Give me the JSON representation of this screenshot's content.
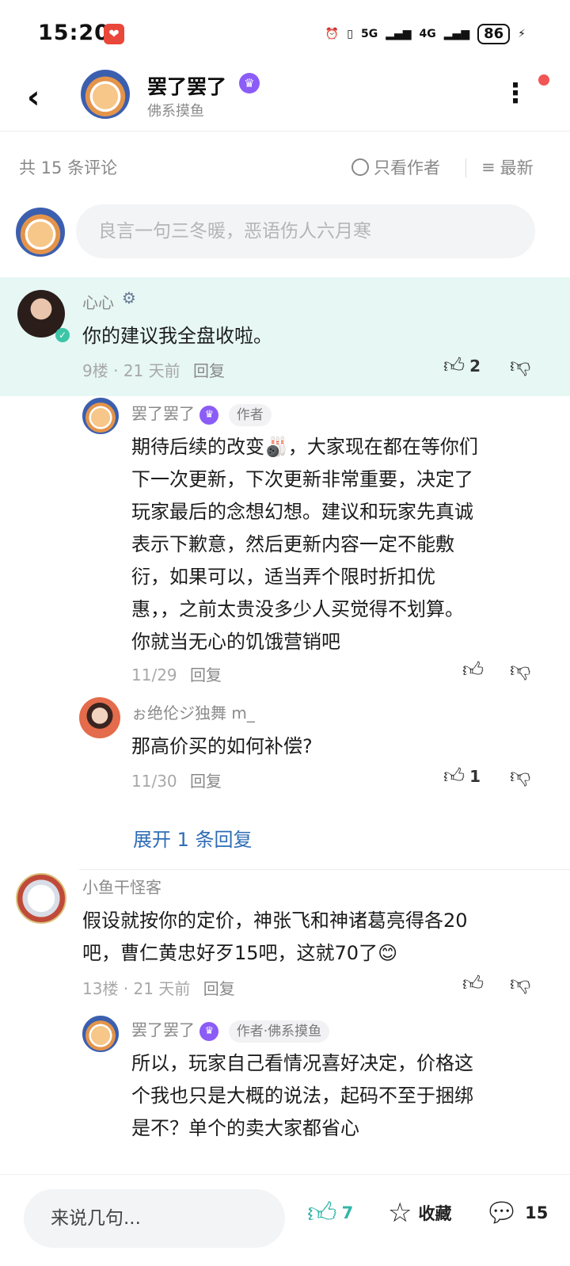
{
  "status_bar": {
    "time": "15:20",
    "signal_5g": "5G",
    "signal_4g": "4G",
    "battery": "86"
  },
  "header": {
    "title": "罢了罢了",
    "subtitle": "佛系摸鱼"
  },
  "comments_bar": {
    "count_label": "共 15 条评论",
    "author_only": "只看作者",
    "sort_label": "最新"
  },
  "input": {
    "placeholder": "良言一句三冬暖，恶语伤人六月寒"
  },
  "comments": [
    {
      "user": "心心",
      "text": "你的建议我全盘收啦。",
      "floor": "9楼",
      "time": "21 天前",
      "reply": "回复",
      "likes": "2"
    },
    {
      "user": "罢了罢了",
      "tag": "作者",
      "lines": [
        "期待后续的改变🎳，大家现在都在等你们",
        "下一次更新，下次更新非常重要，决定了",
        "玩家最后的念想幻想。建议和玩家先真诚",
        "表示下歉意，然后更新内容一定不能敷",
        "衍，如果可以，适当弄个限时折扣优",
        "惠，，之前太贵没多少人买觉得不划算。",
        "你就当无心的饥饿营销吧"
      ],
      "time": "11/29",
      "reply": "回复"
    },
    {
      "user": "ぉ绝伦ジ独舞 m_",
      "text": "那高价买的如何补偿?",
      "time": "11/30",
      "reply": "回复",
      "likes": "1"
    },
    {
      "user": "小鱼干怪客",
      "lines": [
        "假设就按你的定价，神张飞和神诸葛亮得各20",
        "吧，曹仁黄忠好歹15吧，这就70了😊"
      ],
      "floor": "13楼",
      "time": "21 天前",
      "reply": "回复"
    },
    {
      "user": "罢了罢了",
      "tag": "作者·佛系摸鱼",
      "lines": [
        "所以，玩家自己看情况喜好决定，价格这",
        "个我也只是大概的说法，起码不至于捆绑",
        "是不？单个的卖大家都省心"
      ]
    }
  ],
  "expand_label": "展开 1 条回复",
  "bottom_bar": {
    "input_placeholder": "来说几句...",
    "likes": "7",
    "favorite_label": "收藏",
    "comments": "15"
  },
  "colors": {
    "highlight_bg": "#e6f7f4",
    "accent_teal": "#33b6a8",
    "link_blue": "#2f6db5",
    "badge_purple": "#8b5cf6"
  },
  "icons": [
    "back-icon",
    "more-icon",
    "thumb-up-icon",
    "thumb-down-icon",
    "star-icon",
    "comment-icon",
    "sort-icon"
  ]
}
